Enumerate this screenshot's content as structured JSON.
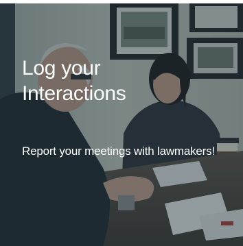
{
  "card": {
    "title_line1": "Log your",
    "title_line2": "Interactions",
    "subtitle": "Report your meetings with lawmakers!",
    "overlay_color": "#1e323c"
  }
}
